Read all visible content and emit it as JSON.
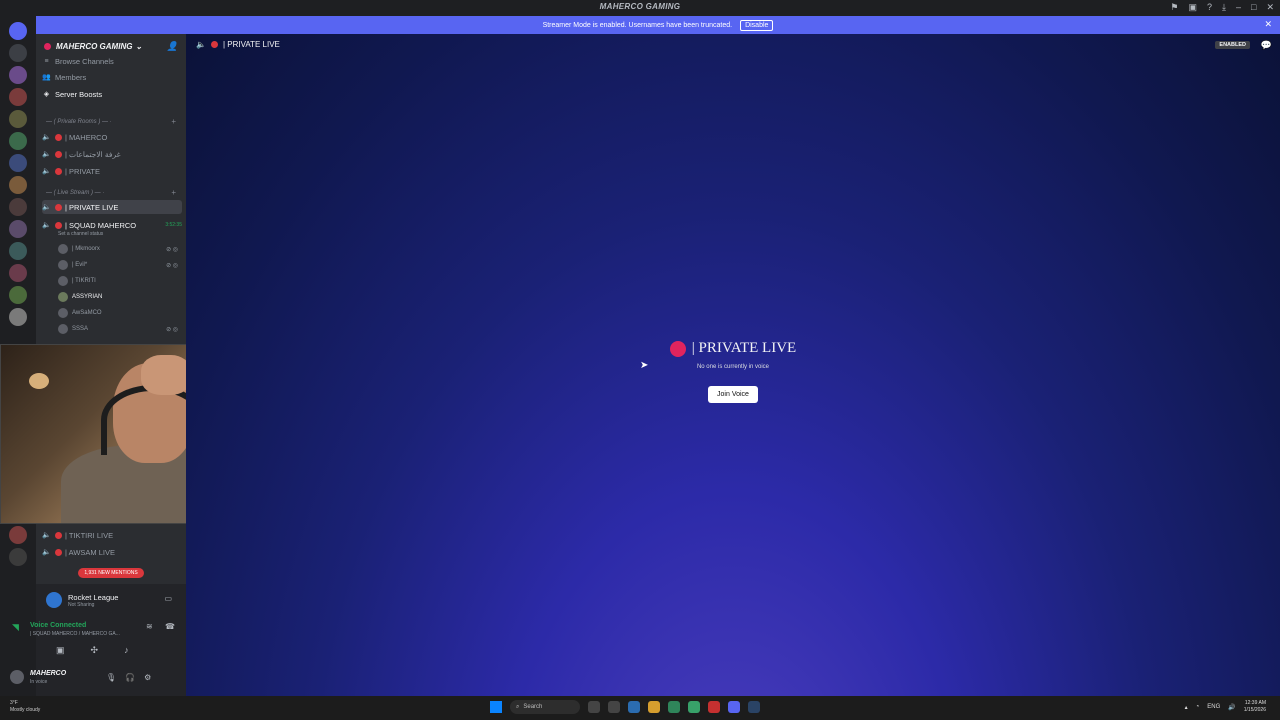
{
  "window": {
    "title": "MAHERCO GAMING"
  },
  "banner": {
    "text": "Streamer Mode is enabled. Usernames have been truncated.",
    "button": "Disable"
  },
  "server": {
    "name": "MAHERCO GAMING"
  },
  "sidebar": {
    "browse": "Browse Channels",
    "members": "Members",
    "boosts": "Server Boosts",
    "cat_private": "— ( Private Rooms ) — ·",
    "ch_maherco": "| MAHERCO",
    "ch_arabic": "| غرفة الاجتماعات",
    "ch_private": "| PRIVATE",
    "cat_live": "— ( Live Stream ) — ·",
    "ch_private_live": "| PRIVATE LIVE",
    "ch_squad": "| SQUAD MAHERCO",
    "squad_time": "3:52:35",
    "squad_status": "Set a channel status",
    "u1": "| Mkmoorx",
    "u2": "| Evil*",
    "u3": "| TIKRITI",
    "u4": "ASSYRIAN",
    "u5": "AwSaMCO",
    "u6": "SSSA",
    "ch_tiktiri": "| TIKTIRI LIVE",
    "ch_awsam": "| AWSAM LIVE",
    "mentions": "1,931 NEW MENTIONS"
  },
  "panel": {
    "game": "Rocket League",
    "game_sub": "Not Sharing",
    "voice": "Voice Connected",
    "voice_sub": "| SQUAD MAHERCO / MAHERCO GA...",
    "username": "MAHERCO",
    "user_status": "In voice"
  },
  "main": {
    "header": "| PRIVATE LIVE",
    "enabled": "ENABLED",
    "title": "| PRIVATE LIVE",
    "subtitle": "No one is currently in voice",
    "join": "Join Voice"
  },
  "taskbar": {
    "weather_temp": "3°F",
    "weather_desc": "Mostly cloudy",
    "search": "Search",
    "lang": "ENG",
    "time": "12:39 AM",
    "date": "1/15/2026"
  },
  "colors": {
    "accent": "#5865f2",
    "live_dot": "#da373c",
    "connected": "#23a55a"
  }
}
